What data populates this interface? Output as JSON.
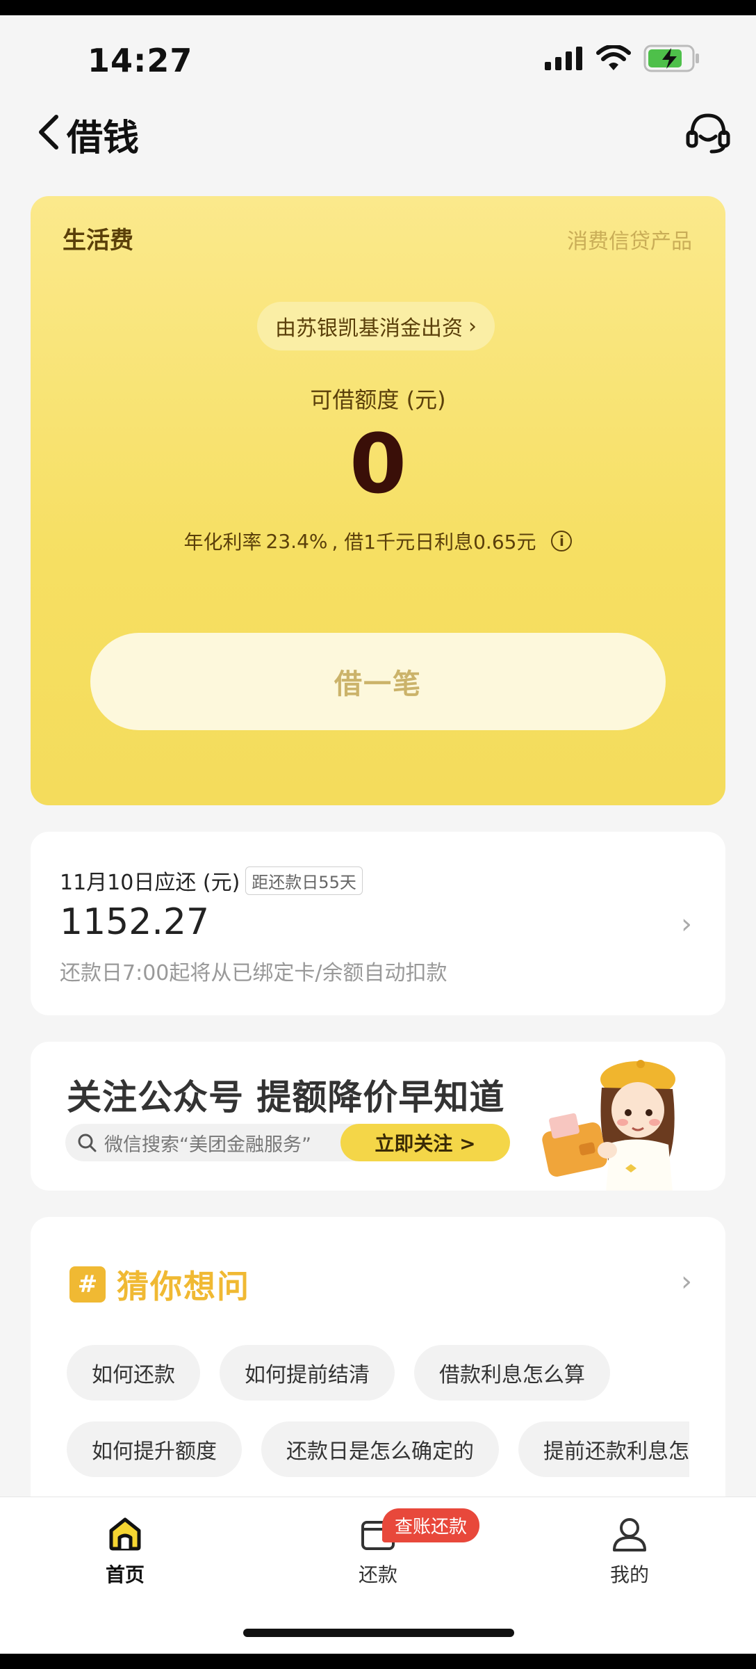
{
  "status_bar": {
    "time": "14:27"
  },
  "nav": {
    "title": "借钱"
  },
  "loan_card": {
    "product_name": "生活费",
    "product_type": "消费信贷产品",
    "funder": "由苏银凯基消金出资",
    "credit_label": "可借额度 (元)",
    "credit_value": "0",
    "rate_label": "年化利率",
    "rate_value": "23.4%",
    "rate_note": ", 借1千元日利息0.65元",
    "borrow_button": "借一笔"
  },
  "repay_card": {
    "due_label": "11月10日应还 (元)",
    "due_badge": "距还款日55天",
    "amount": "1152.27",
    "note": "还款日7:00起将从已绑定卡/余额自动扣款"
  },
  "banner": {
    "title": "关注公众号 提额降价早知道",
    "search_text": "微信搜索“美团金融服务”",
    "follow_button": "立即关注 >"
  },
  "faq": {
    "title": "猜你想问",
    "row1": [
      "如何还款",
      "如何提前结清",
      "借款利息怎么算"
    ],
    "row2": [
      "如何提升额度",
      "还款日是怎么确定的",
      "提前还款利息怎么算"
    ]
  },
  "tab_bar": {
    "home": "首页",
    "repay": "还款",
    "repay_badge": "查账还款",
    "mine": "我的"
  },
  "colors": {
    "card_yellow": "#f6df62",
    "accent_brown": "#5a3f0a",
    "faq_orange": "#f0b933",
    "badge_red": "#e8483b"
  }
}
